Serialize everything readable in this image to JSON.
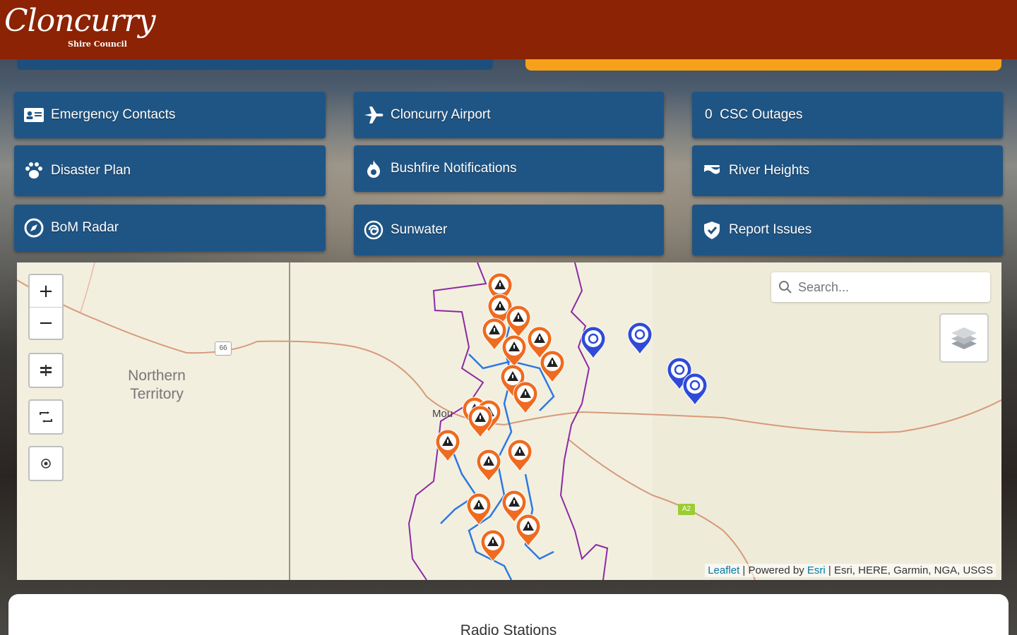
{
  "header": {
    "logo_script": "Cloncurry",
    "logo_sub": "Shire Council",
    "bg_color": "#8b2304"
  },
  "tiles": [
    {
      "label": "Emergency Contacts",
      "icon": "contact-card-icon"
    },
    {
      "label": "Cloncurry Airport",
      "icon": "airplane-icon"
    },
    {
      "label": "0  CSC Outages",
      "icon": ""
    },
    {
      "label": "Disaster Plan",
      "icon": "paw-icon"
    },
    {
      "label": "Bushfire Notifications",
      "icon": "fire-icon"
    },
    {
      "label": "River Heights",
      "icon": "water-level-icon"
    },
    {
      "label": "BoM Radar",
      "icon": "compass-icon"
    },
    {
      "label": "Sunwater",
      "icon": "swirl-icon"
    },
    {
      "label": "Report Issues",
      "icon": "shield-check-icon"
    }
  ],
  "map": {
    "zoom_in": "+",
    "zoom_out": "−",
    "search_placeholder": "Search...",
    "region_label_line1": "Northern",
    "region_label_line2": "Territory",
    "town_label": "Mou",
    "highway_badge": "66",
    "route_badge": "A2",
    "attribution_leaflet": "Leaflet",
    "attribution_sep1": " | Powered by ",
    "attribution_esri": "Esri",
    "attribution_rest": " | Esri, HERE, Garmin, NGA, USGS",
    "warning_marker_color": "#ee6b1f",
    "info_marker_color": "#2f4bd6"
  },
  "bottom": {
    "title": "Radio Stations"
  },
  "colors": {
    "tile_bg": "#1f5585",
    "accent_orange": "#f7a11a"
  }
}
